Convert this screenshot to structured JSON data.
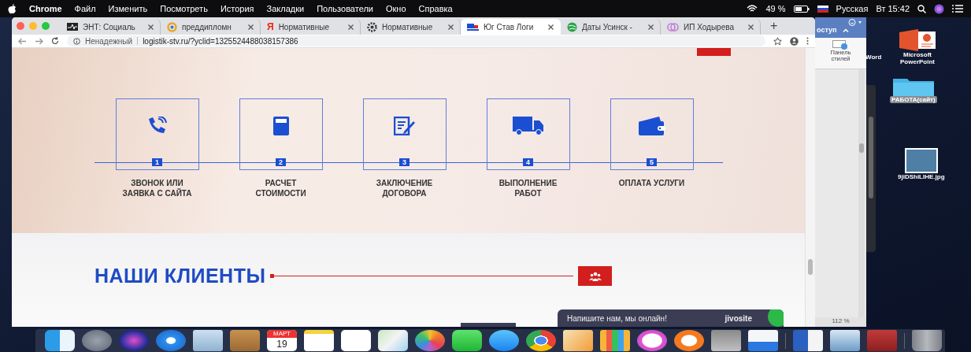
{
  "menu_bar": {
    "app": "Chrome",
    "items": [
      "Файл",
      "Изменить",
      "Посмотреть",
      "История",
      "Закладки",
      "Пользователи",
      "Окно",
      "Справка"
    ],
    "battery": "49 %",
    "input_source": "Русская",
    "clock": "Вт 15:42"
  },
  "browser": {
    "tabs": [
      {
        "title": "ЭНТ: Социаль",
        "selected": false
      },
      {
        "title": "преддипломн",
        "selected": false
      },
      {
        "title": "Нормативные",
        "glyph": "Я",
        "selected": false
      },
      {
        "title": "Нормативные",
        "selected": false
      },
      {
        "title": "Юг Став Логи",
        "selected": true
      },
      {
        "title": "Даты Усинск -",
        "selected": false
      },
      {
        "title": "ИП Ходырева",
        "selected": false
      }
    ],
    "new_tab": "+",
    "address": {
      "security": "Ненадежный",
      "url": "logistik-stv.ru/?yclid=1325524488038157386"
    }
  },
  "page": {
    "steps": [
      {
        "number": "1",
        "label": "ЗВОНОК ИЛИ\nЗАЯВКА С САЙТА"
      },
      {
        "number": "2",
        "label": "РАСЧЕТ\nСТОИМОСТИ"
      },
      {
        "number": "3",
        "label": "ЗАКЛЮЧЕНИЕ\nДОГОВОРА"
      },
      {
        "number": "4",
        "label": "ВЫПОЛНЕНИЕ\nРАБОТ"
      },
      {
        "number": "5",
        "label": "ОПЛАТА УСЛУГИ"
      }
    ],
    "clients_heading": "НАШИ КЛИЕНТЫ",
    "chat": {
      "message": "Напишите нам, мы онлайн!",
      "brand": "jivosite"
    }
  },
  "word_window": {
    "ribbon_tab": "оступ",
    "ribbon_button": "Панель\nстилей",
    "zoom": "112 %"
  },
  "desktop_icons": [
    {
      "label": "Word",
      "kind": "text",
      "selected": false
    },
    {
      "label": "Microsoft\nPowerPoint",
      "kind": "presentation",
      "selected": false
    },
    {
      "label": "РАБОТА(сайт)",
      "kind": "folder",
      "selected": true
    },
    {
      "label": "9jiDShiLIHE.jpg",
      "kind": "photo",
      "selected": false
    }
  ],
  "dock": {
    "calendar_month": "МАРТ",
    "calendar_day": "19"
  }
}
